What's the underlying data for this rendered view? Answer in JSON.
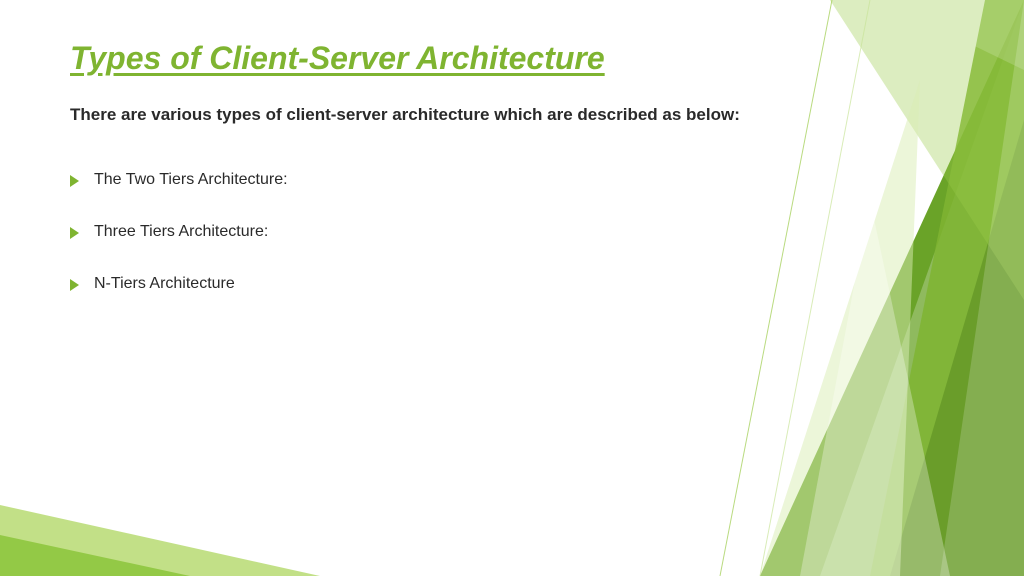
{
  "title": "Types of Client-Server Architecture",
  "intro": "There are various types of client-server architecture which are described as below:",
  "bullets": [
    "The Two Tiers Architecture:",
    "Three Tiers Architecture:",
    "N-Tiers Architecture"
  ],
  "colors": {
    "accent": "#7fb431",
    "text": "#2a2a2a"
  }
}
